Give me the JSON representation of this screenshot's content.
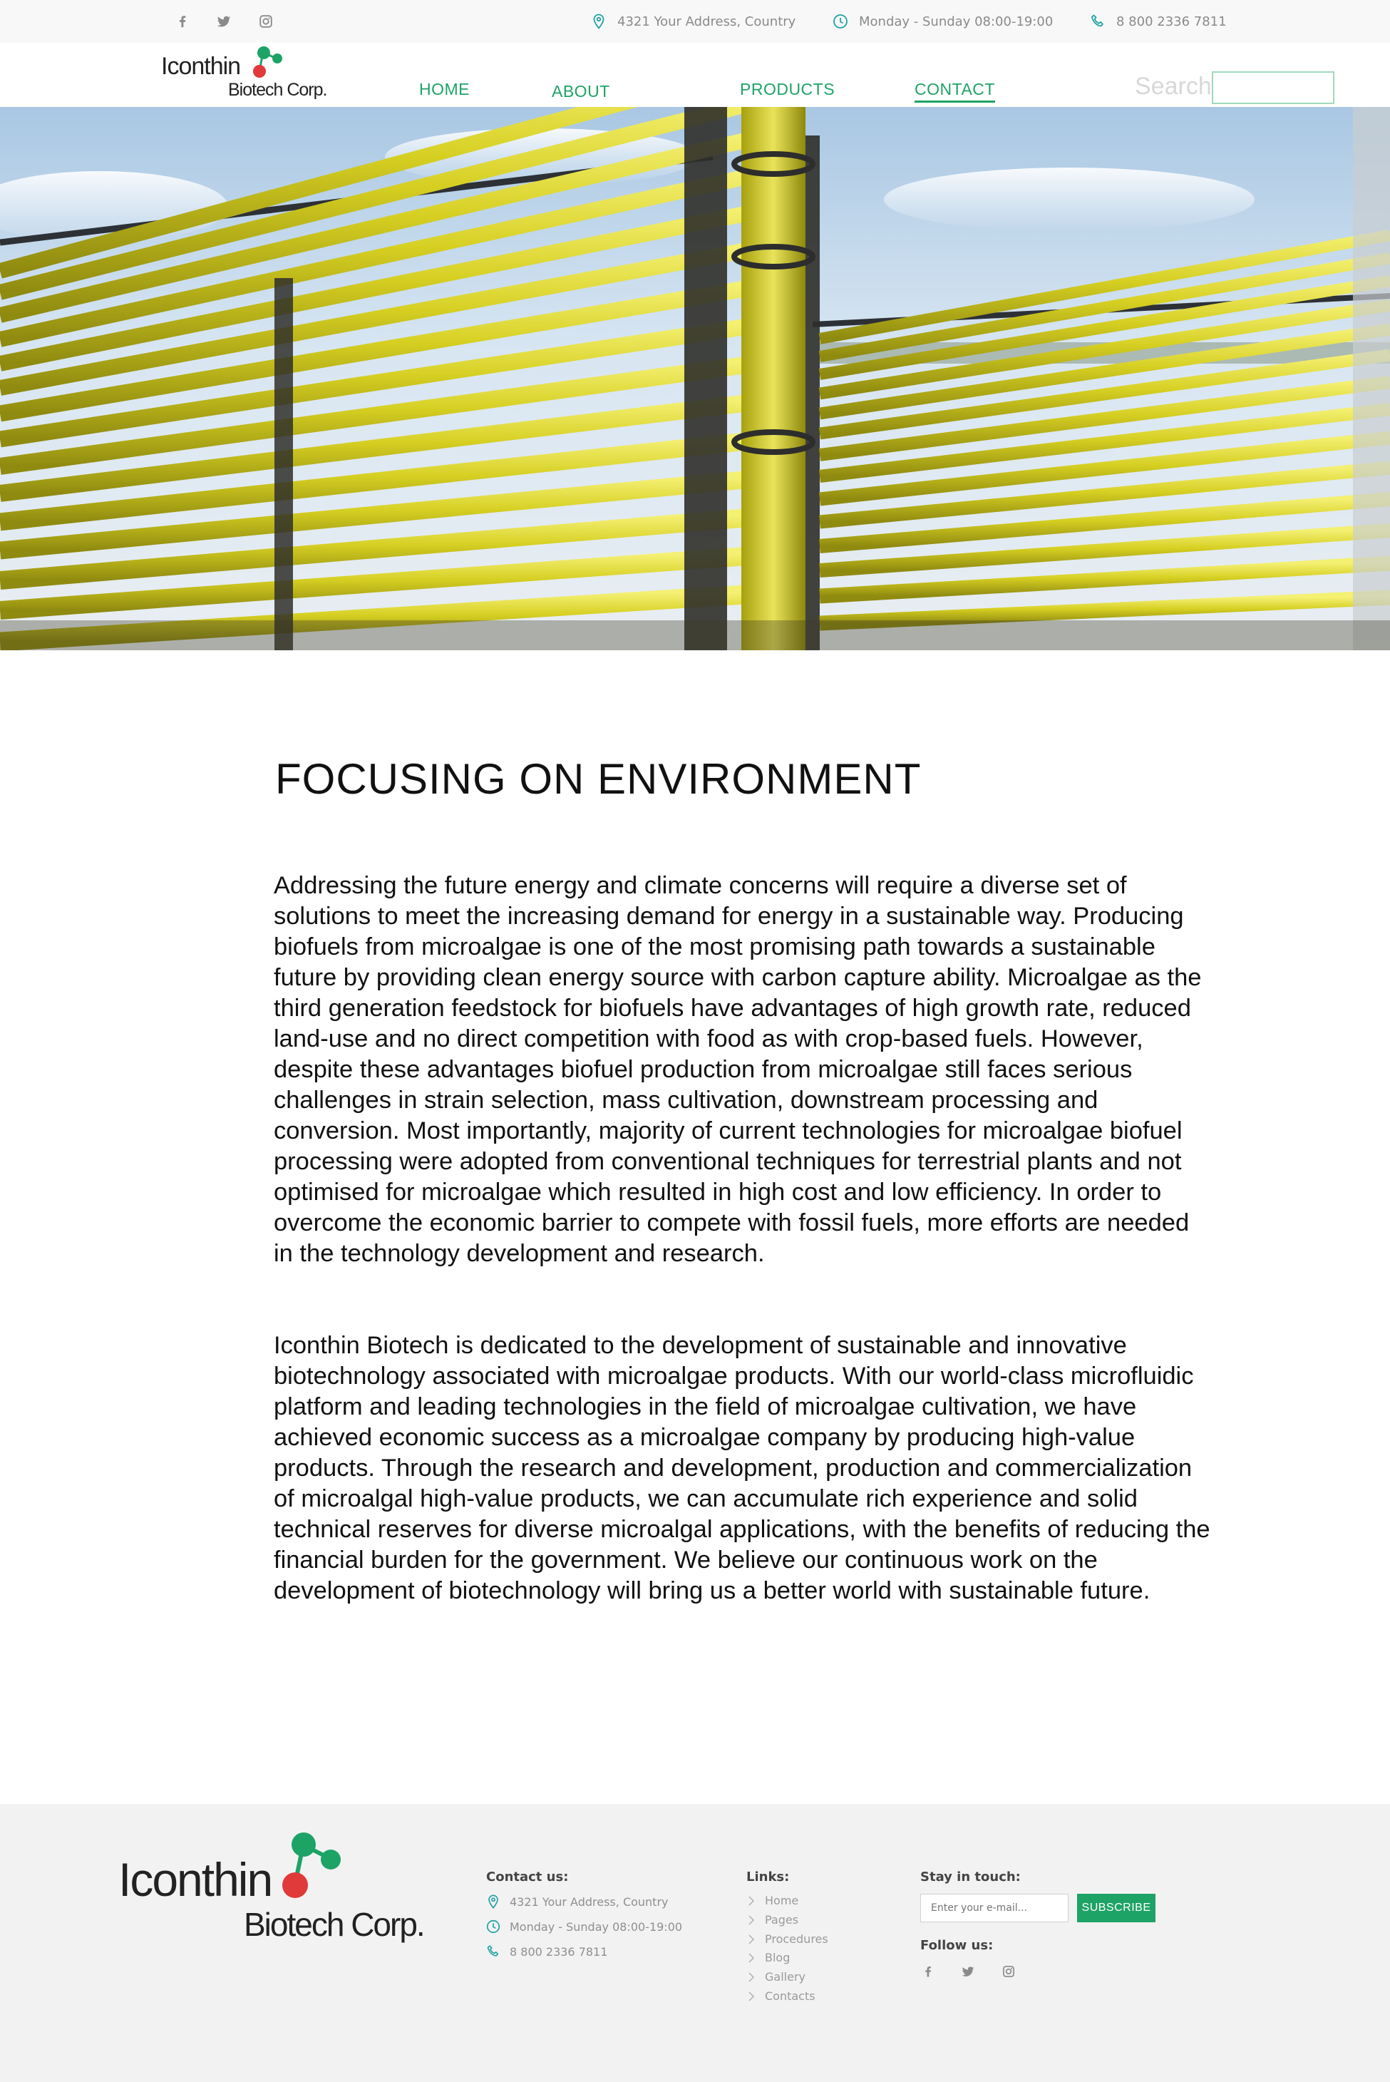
{
  "topbar": {
    "social": [
      "facebook-icon",
      "twitter-icon",
      "instagram-icon"
    ],
    "address": "4321 Your Address, Country",
    "hours": "Monday - Sunday 08:00-19:00",
    "phone": "8 800 2336 7811"
  },
  "brand": {
    "line1": "Iconthin",
    "line2": "Biotech Corp.",
    "colors": {
      "green": "#1ea366",
      "red": "#e03a3a"
    }
  },
  "nav": {
    "items": [
      {
        "label": "HOME"
      },
      {
        "label": "ABOUT"
      },
      {
        "label": "PRODUCTS"
      },
      {
        "label": "CONTACT"
      }
    ],
    "active": "CONTACT"
  },
  "search": {
    "label": "Search",
    "placeholder": ""
  },
  "content": {
    "title": "FOCUSING ON ENVIRONMENT",
    "p1": "Addressing the future energy and climate concerns will require a diverse set of solutions to meet the increasing demand for energy in a sustainable way. Producing biofuels from microalgae is one of the most promising path towards a sustainable future by providing clean energy source with carbon capture ability. Microalgae as the third generation feedstock for biofuels have advantages of high growth rate, reduced land-use and no direct competition with food as with crop-based fuels. However, despite these advantages biofuel production from microalgae still faces serious challenges in strain selection, mass cultivation, downstream processing and conversion. Most importantly, majority of current technologies for microalgae biofuel processing were adopted from conventional techniques for terrestrial plants and not optimised for microalgae which resulted in high cost and low efficiency. In order to overcome the economic barrier to compete with fossil fuels, more efforts are needed in the technology development and research.",
    "p2": "Iconthin Biotech is dedicated to the development of sustainable and innovative biotechnology associated with microalgae products. With our world-class microfluidic platform and leading technologies in the field of microalgae cultivation, we have achieved economic success as a microalgae company by producing high-value products. Through the research and development, production and commercialization of microalgal high-value products, we can accumulate rich experience and solid technical reserves for diverse microalgal applications, with the benefits of reducing the financial burden for the government. We believe our continuous work on the development of biotechnology will bring us a better world with sustainable future."
  },
  "footer": {
    "contact_heading": "Contact us:",
    "address": "4321 Your Address, Country",
    "hours": "Monday - Sunday 08:00-19:00",
    "phone": "8 800 2336 7811",
    "links_heading": "Links:",
    "links": [
      "Home",
      "Pages",
      "Procedures",
      "Blog",
      "Gallery",
      "Contacts"
    ],
    "stay_heading": "Stay in touch:",
    "email_placeholder": "Enter your e-mail...",
    "subscribe_label": "SUBSCRIBE",
    "follow_heading": "Follow us:"
  }
}
